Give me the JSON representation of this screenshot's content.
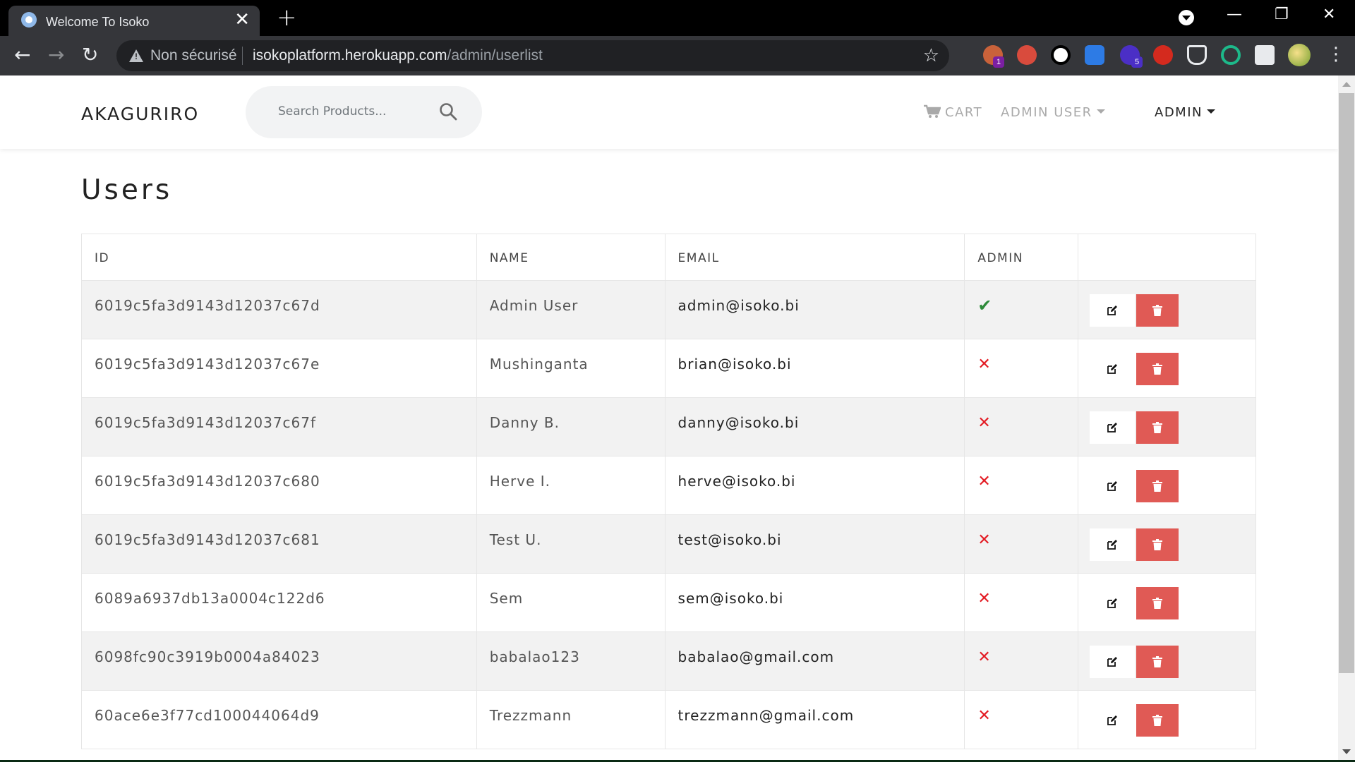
{
  "browser": {
    "tab_title": "Welcome To Isoko",
    "tab_close": "✕",
    "new_tab": "+",
    "not_secure_label": "Non sécurisé",
    "url_host": "isokoplatform.herokuapp.com",
    "url_path": "/admin/userlist",
    "extension_badges": [
      "1",
      "5"
    ],
    "window_controls": {
      "minimize": "—",
      "restore": "❐",
      "close": "✕"
    }
  },
  "navbar": {
    "brand": "AKAGURIRO",
    "search_placeholder": "Search Products...",
    "cart_label": "CART",
    "user_menu_label": "ADMIN USER",
    "admin_menu_label": "ADMIN"
  },
  "page": {
    "title": "Users",
    "columns": {
      "id": "ID",
      "name": "NAME",
      "email": "EMAIL",
      "admin": "ADMIN",
      "actions": ""
    },
    "users": [
      {
        "id": "6019c5fa3d9143d12037c67d",
        "name": "Admin User",
        "email": "admin@isoko.bi",
        "is_admin": true,
        "admin_icon": "✔"
      },
      {
        "id": "6019c5fa3d9143d12037c67e",
        "name": "Mushinganta",
        "email": "brian@isoko.bi",
        "is_admin": false,
        "admin_icon": "✕"
      },
      {
        "id": "6019c5fa3d9143d12037c67f",
        "name": "Danny B.",
        "email": "danny@isoko.bi",
        "is_admin": false,
        "admin_icon": "✕"
      },
      {
        "id": "6019c5fa3d9143d12037c680",
        "name": "Herve I.",
        "email": "herve@isoko.bi",
        "is_admin": false,
        "admin_icon": "✕"
      },
      {
        "id": "6019c5fa3d9143d12037c681",
        "name": "Test U.",
        "email": "test@isoko.bi",
        "is_admin": false,
        "admin_icon": "✕"
      },
      {
        "id": "6089a6937db13a0004c122d6",
        "name": "Sem",
        "email": "sem@isoko.bi",
        "is_admin": false,
        "admin_icon": "✕"
      },
      {
        "id": "6098fc90c3919b0004a84023",
        "name": "babalao123",
        "email": "babalao@gmail.com",
        "is_admin": false,
        "admin_icon": "✕"
      },
      {
        "id": "60ace6e3f77cd100044064d9",
        "name": "Trezzmann",
        "email": "trezzmann@gmail.com",
        "is_admin": false,
        "admin_icon": "✕"
      }
    ]
  },
  "colors": {
    "delete_button": "#e05a55",
    "admin_yes": "#2e8b3a",
    "admin_no": "#e31b23",
    "row_stripe": "#f2f2f2"
  },
  "icons": {
    "edit": "edit-icon",
    "delete": "trash-icon",
    "cart": "cart-icon",
    "search": "search-icon"
  }
}
